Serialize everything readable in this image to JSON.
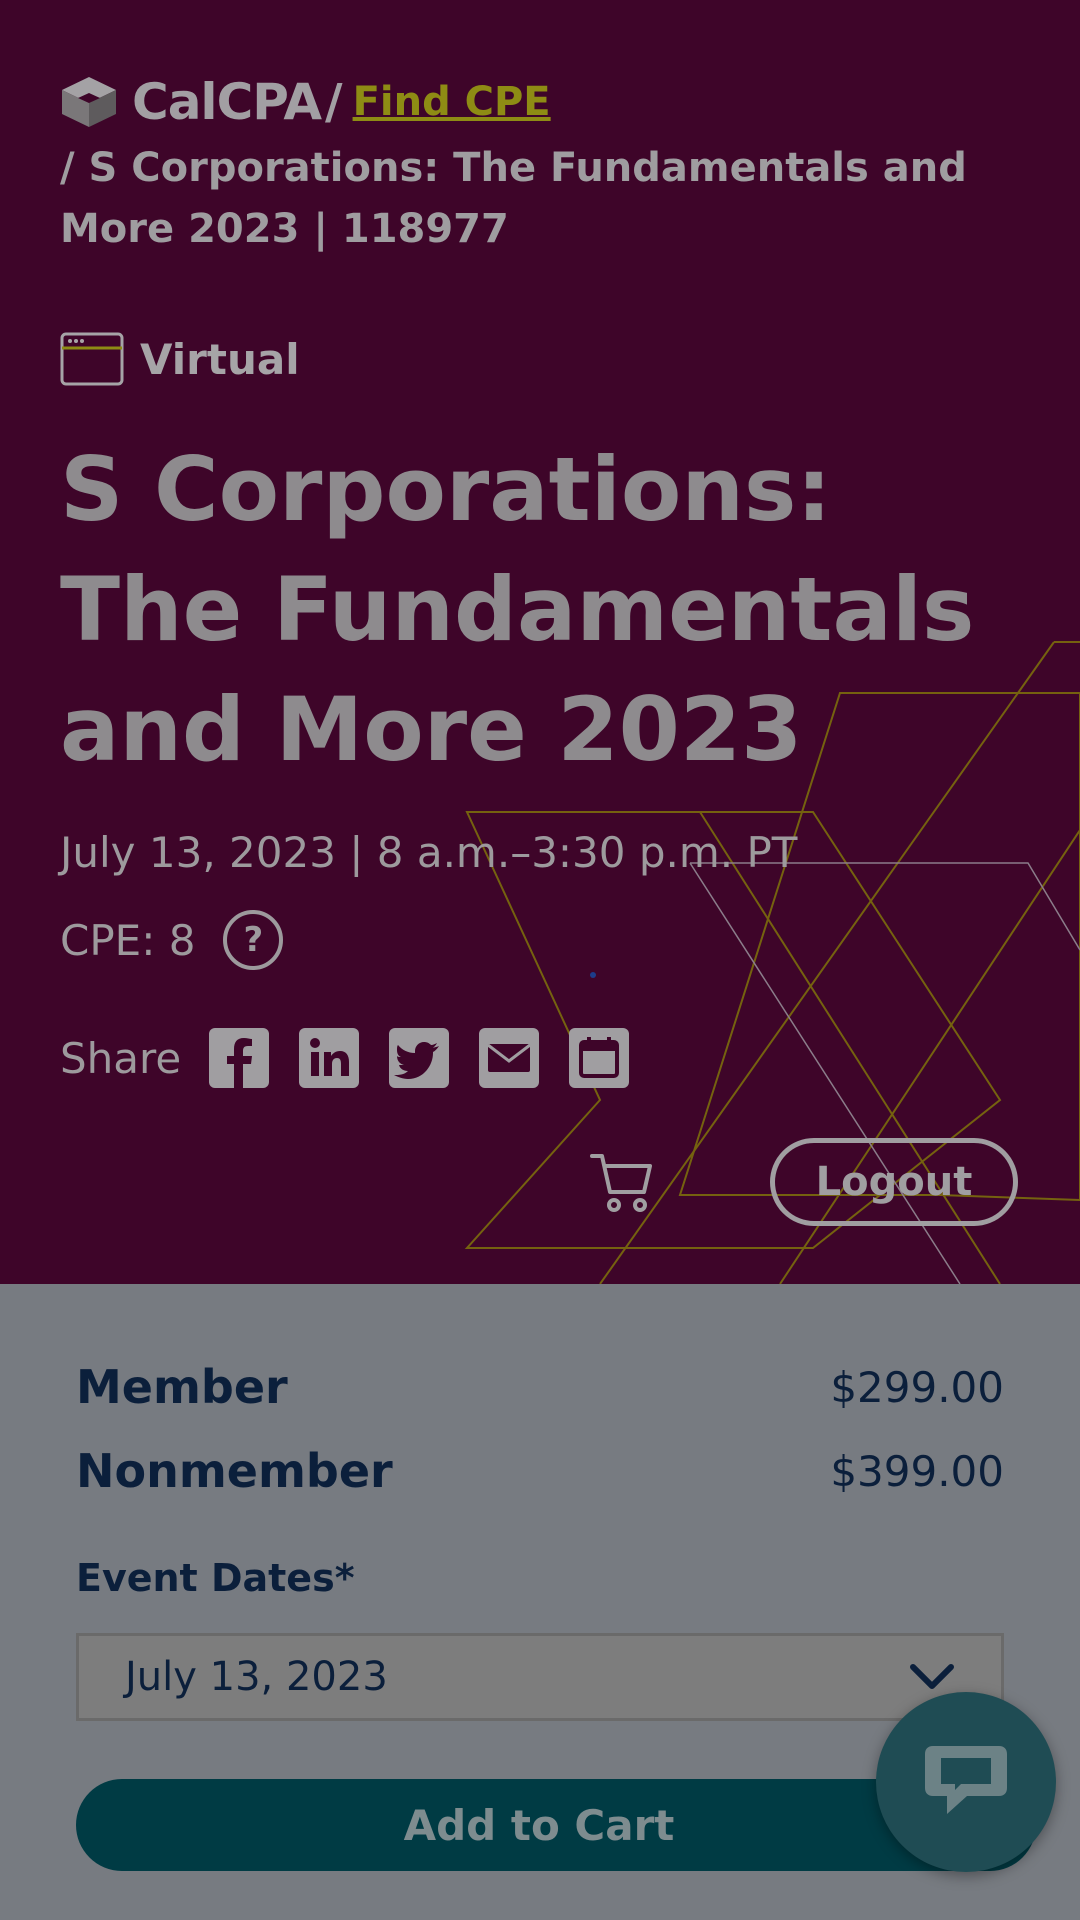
{
  "header": {
    "logo_text": "CalCPA",
    "logo_icon": "calcpa-cube-logo",
    "separator": "/",
    "find_link": "Find CPE",
    "current_crumb": "/ S Corporations: The Fundamentals and More 2023 | 118977"
  },
  "event": {
    "format_icon": "browser-window-icon",
    "format": "Virtual",
    "title": "S Corporations: The Fundamentals and More 2023",
    "datetime": "July 13, 2023 | 8 a.m.–3:30 p.m. PT",
    "cpe": "CPE: 8",
    "help_glyph": "?"
  },
  "share": {
    "label": "Share",
    "icons": [
      "facebook-icon",
      "linkedin-icon",
      "twitter-icon",
      "email-icon",
      "calendar-icon"
    ]
  },
  "actions": {
    "cart_icon": "cart-icon",
    "logout_label": "Logout"
  },
  "pricing": {
    "member_label": "Member",
    "member_price": "$299.00",
    "nonmember_label": "Nonmember",
    "nonmember_price": "$399.00"
  },
  "registration": {
    "dates_label": "Event Dates*",
    "selected_date": "July 13, 2023",
    "add_to_cart_label": "Add to Cart"
  },
  "colors": {
    "hero_bg": "#3e0529",
    "page_overlay": "#777b81",
    "link": "#8e8c14",
    "navy_text": "#0b1f3b",
    "button_teal": "#003b44",
    "chat_bubble": "#1f4c54"
  }
}
